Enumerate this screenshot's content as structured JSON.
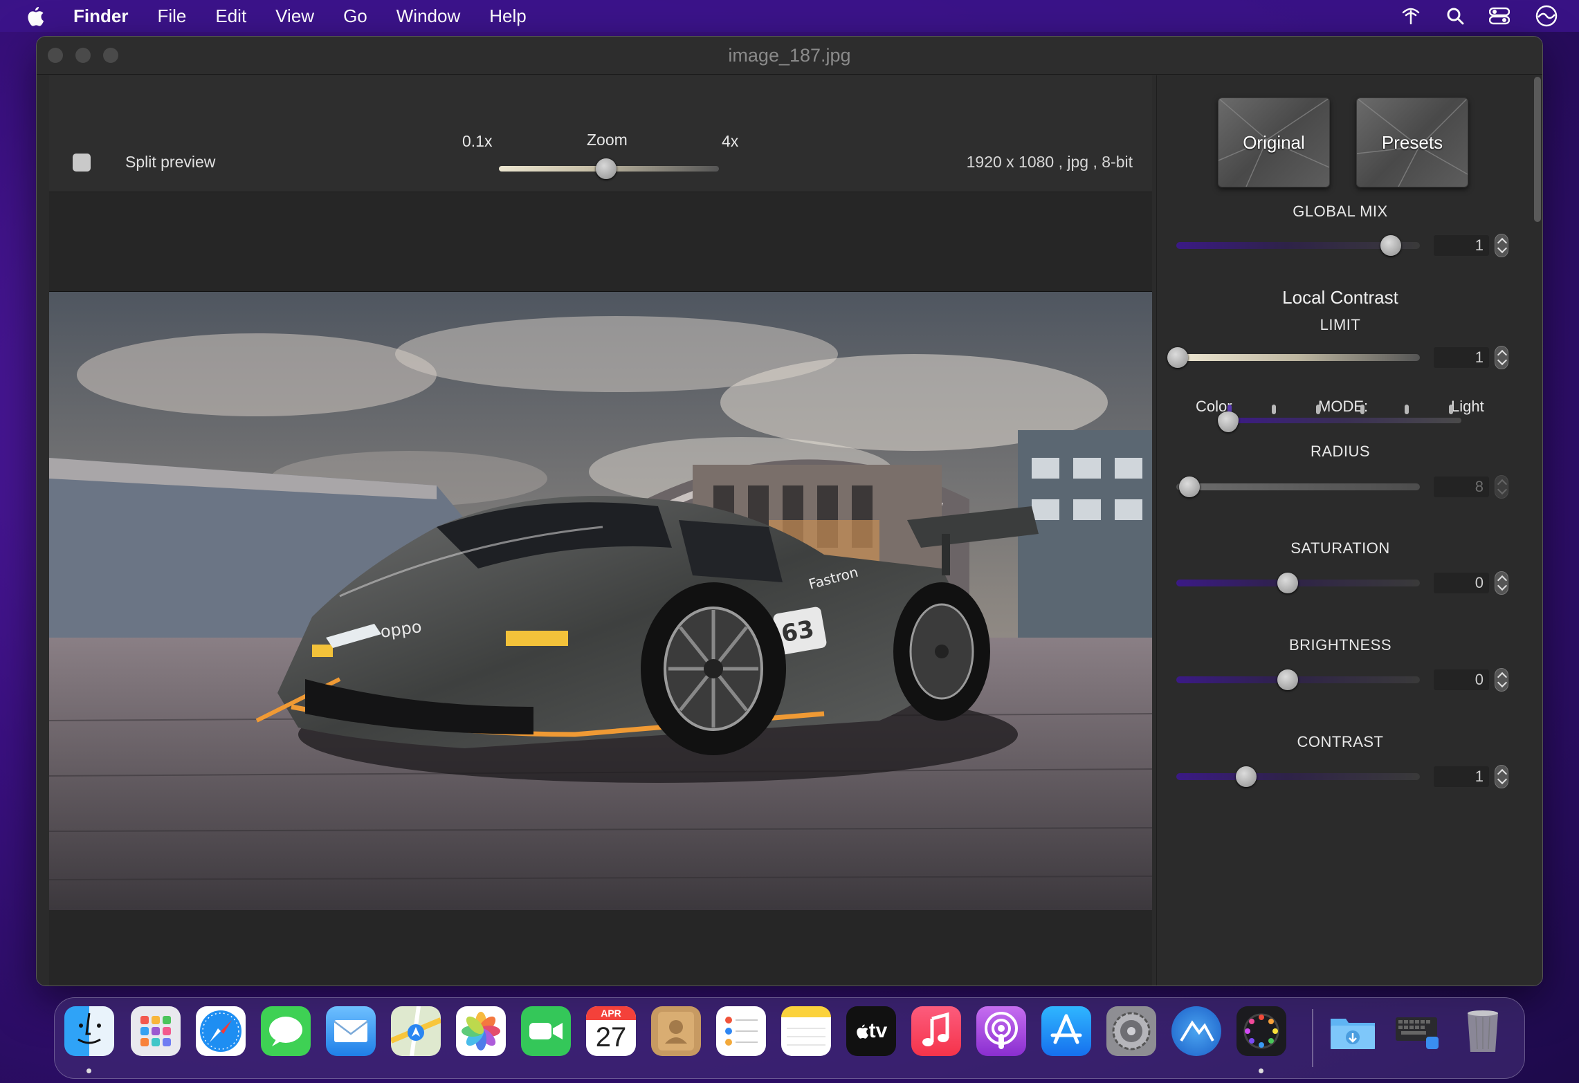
{
  "menubar": {
    "app": "Finder",
    "items": [
      "File",
      "Edit",
      "View",
      "Go",
      "Window",
      "Help"
    ],
    "status_icons": [
      "wifi-icon",
      "search-icon",
      "control-center-icon",
      "siri-icon"
    ]
  },
  "window": {
    "title": "image_187.jpg"
  },
  "toolbar": {
    "split_preview_label": "Split preview",
    "split_preview_checked": false,
    "zoom_label": "Zoom",
    "zoom_min": "0.1x",
    "zoom_max": "4x",
    "image_info": "1920 x 1080 , jpg , 8-bit"
  },
  "panel": {
    "original_button": "Original",
    "presets_button": "Presets",
    "global_mix": {
      "label": "GLOBAL MIX",
      "value": "1"
    },
    "local_contrast_title": "Local Contrast",
    "limit": {
      "label": "LIMIT",
      "value": "1"
    },
    "mode": {
      "label": "MODE:",
      "left": "Color",
      "right": "Light"
    },
    "radius": {
      "label": "RADIUS",
      "value": "8"
    },
    "saturation": {
      "label": "SATURATION",
      "value": "0"
    },
    "brightness": {
      "label": "BRIGHTNESS",
      "value": "0"
    },
    "contrast": {
      "label": "CONTRAST",
      "value": "1"
    }
  },
  "dock": {
    "calendar_month": "APR",
    "calendar_day": "27",
    "tv_label": "tv",
    "apps": [
      "finder-icon",
      "launchpad-icon",
      "safari-icon",
      "messages-icon",
      "mail-icon",
      "maps-icon",
      "photos-icon",
      "facetime-icon",
      "calendar-icon",
      "contacts-icon",
      "reminders-icon",
      "notes-icon",
      "apple-tv-icon",
      "music-icon",
      "podcasts-icon",
      "app-store-icon",
      "system-preferences-icon",
      "image-editor-icon",
      "color-app-icon",
      "downloads-folder-icon",
      "keyboard-viewer-icon",
      "trash-icon"
    ]
  }
}
